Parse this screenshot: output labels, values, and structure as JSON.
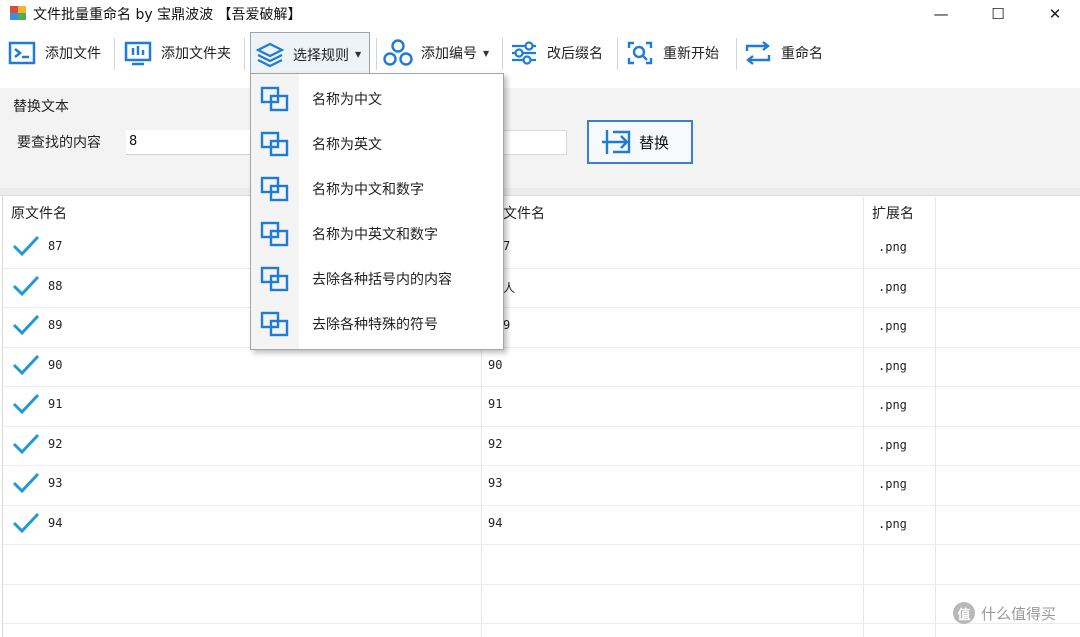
{
  "window": {
    "title": "文件批量重命名 by 宝鼎波波 【吾爱破解】",
    "minimize_glyph": "—",
    "maximize_glyph": "☐",
    "close_glyph": "✕"
  },
  "toolbar": {
    "add_file": "添加文件",
    "add_folder": "添加文件夹",
    "select_rule": "选择规则",
    "add_number": "添加编号",
    "change_ext": "改后缀名",
    "restart": "重新开始",
    "rename": "重命名",
    "accent_color": "#1e7bd6"
  },
  "replace_panel": {
    "title": "替换文本",
    "find_label": "要查找的内容",
    "find_value": "8",
    "replace_button": "替换"
  },
  "table": {
    "headers": {
      "original": "原文件名",
      "new_visible": "文件名",
      "ext": "扩展名"
    },
    "rows": [
      {
        "original": "87",
        "new": "7",
        "ext": ".png"
      },
      {
        "original": "88",
        "new": "人",
        "ext": ".png"
      },
      {
        "original": "89",
        "new": "9",
        "ext": ".png"
      },
      {
        "original": "90",
        "new": "90",
        "ext": ".png"
      },
      {
        "original": "91",
        "new": "91",
        "ext": ".png"
      },
      {
        "original": "92",
        "new": "92",
        "ext": ".png"
      },
      {
        "original": "93",
        "new": "93",
        "ext": ".png"
      },
      {
        "original": "94",
        "new": "94",
        "ext": ".png"
      }
    ]
  },
  "menu": {
    "items": [
      {
        "label": "名称为中文"
      },
      {
        "label": "名称为英文"
      },
      {
        "label": "名称为中文和数字"
      },
      {
        "label": "名称为中英文和数字"
      },
      {
        "label": "去除各种括号内的内容"
      },
      {
        "label": "去除各种特殊的符号"
      }
    ]
  },
  "watermark": {
    "badge": "值",
    "text": "什么值得买"
  }
}
